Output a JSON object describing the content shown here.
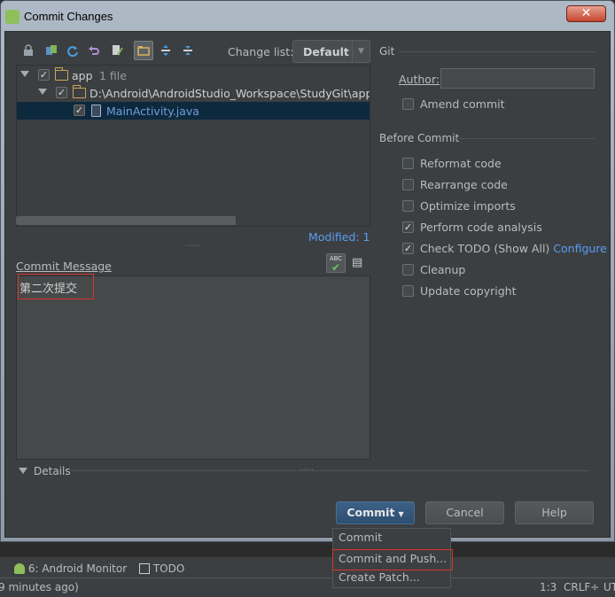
{
  "window": {
    "title": "Commit Changes",
    "close_label": "✕"
  },
  "toolbar": {
    "icons": [
      "lock-icon",
      "diff-icon",
      "refresh-icon",
      "revert-icon",
      "edit-icon",
      "group-by-directory-icon",
      "expand-all-icon",
      "collapse-all-icon"
    ],
    "change_list_label": "Change list:",
    "change_list_value": "Default"
  },
  "tree": {
    "rows": [
      {
        "name": "app",
        "count": "1 file",
        "checked": true
      },
      {
        "path": "D:\\Android\\AndroidStudio_Workspace\\StudyGit\\app\\s",
        "checked": true
      },
      {
        "file": "MainActivity.java",
        "checked": true,
        "selected": true
      }
    ],
    "modified": "Modified: 1"
  },
  "commit_message": {
    "label": "Commit Message",
    "text": "第二次提交"
  },
  "details": {
    "label": "Details"
  },
  "git": {
    "section_title": "Git",
    "author_label": "Author:",
    "author_value": "",
    "amend_label": "Amend commit"
  },
  "before_commit": {
    "section_title": "Before Commit",
    "options": [
      {
        "label": "Reformat code",
        "checked": false
      },
      {
        "label": "Rearrange code",
        "checked": false
      },
      {
        "label": "Optimize imports",
        "checked": false
      },
      {
        "label": "Perform code analysis",
        "checked": true
      },
      {
        "label": "Check TODO (Show All)",
        "checked": true,
        "link": "Configure"
      },
      {
        "label": "Cleanup",
        "checked": false
      },
      {
        "label": "Update copyright",
        "checked": false
      }
    ]
  },
  "buttons": {
    "commit": "Commit",
    "cancel": "Cancel",
    "help": "Help"
  },
  "commit_menu": [
    "Commit",
    "Commit and Push...",
    "Create Patch..."
  ],
  "tool_windows": {
    "android_monitor": "6: Android Monitor",
    "todo": "TODO"
  },
  "status": {
    "left": "9 minutes ago)",
    "position": "1:3",
    "line_sep": "CRLF÷",
    "encoding": "UT"
  },
  "colors": {
    "accent": "#589df6",
    "highlight_box": "#d9342b",
    "selection": "#0d293e"
  }
}
